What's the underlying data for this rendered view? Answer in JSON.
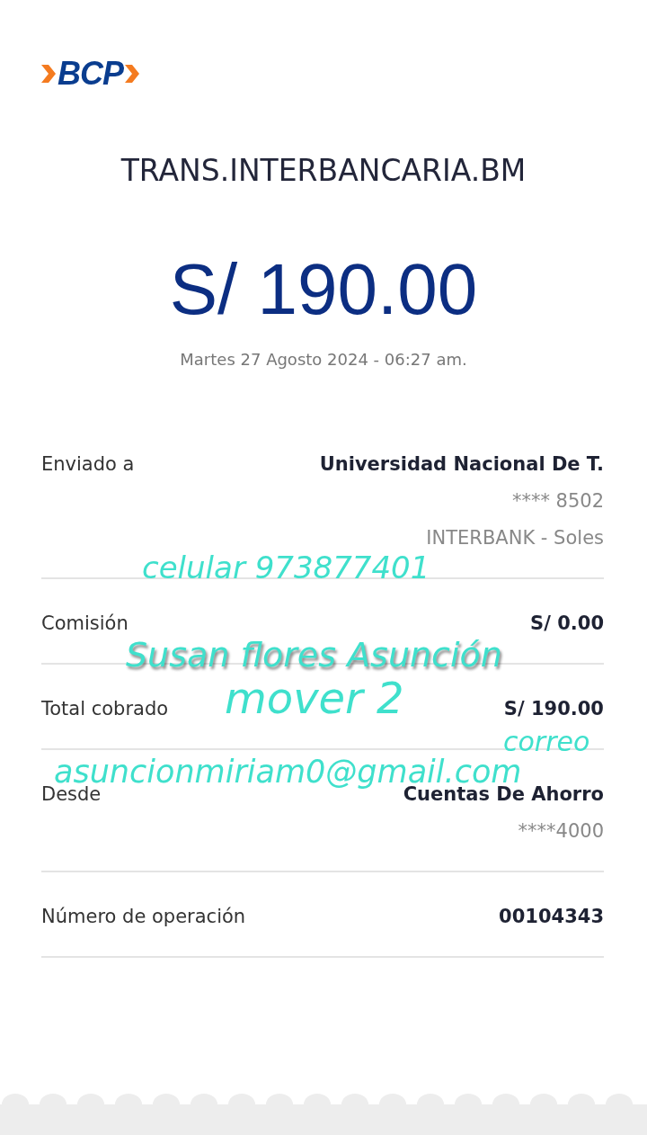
{
  "logo": {
    "text": "BCP"
  },
  "title": "TRANS.INTERBANCARIA.BM",
  "amount": "S/ 190.00",
  "date": "Martes 27 Agosto 2024 - 06:27 am.",
  "rows": [
    {
      "label": "Enviado a",
      "values": [
        {
          "text": "Universidad Nacional De T.",
          "kind": "strong"
        },
        {
          "text": "**** 8502",
          "kind": "muted"
        },
        {
          "text": "INTERBANK - Soles",
          "kind": "muted"
        }
      ]
    },
    {
      "label": "Comisión",
      "values": [
        {
          "text": "S/ 0.00",
          "kind": "strong"
        }
      ]
    },
    {
      "label": "Total cobrado",
      "values": [
        {
          "text": "S/ 190.00",
          "kind": "strong"
        }
      ]
    },
    {
      "label": "Desde",
      "values": [
        {
          "text": "Cuentas De Ahorro",
          "kind": "strong"
        },
        {
          "text": "****4000",
          "kind": "muted"
        }
      ]
    },
    {
      "label": "Número de operación",
      "values": [
        {
          "text": "00104343",
          "kind": "strong"
        }
      ]
    }
  ],
  "annotations": [
    {
      "text": "celular 973877401"
    },
    {
      "text": "Susan flores Asunción"
    },
    {
      "text": "mover 2"
    },
    {
      "text": "correo"
    },
    {
      "text": "asuncionmiriam0@gmail.com"
    }
  ]
}
